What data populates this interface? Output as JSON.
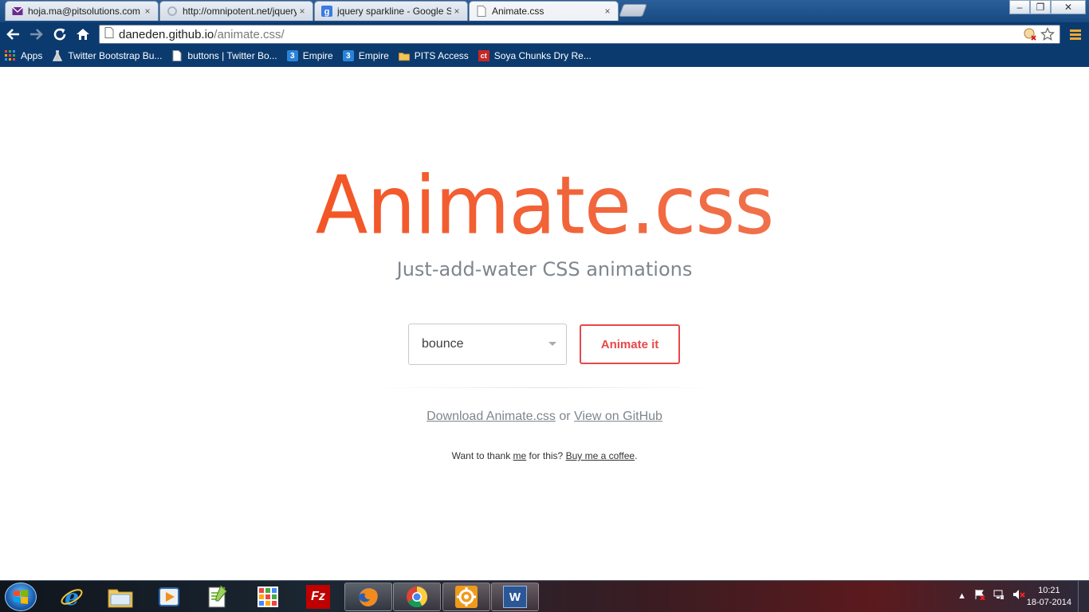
{
  "browser": {
    "tabs": [
      {
        "label": "hoja.ma@pitsolutions.com",
        "icon": "mail-icon",
        "active": false
      },
      {
        "label": "http://omnipotent.net/jquery",
        "icon": "loading-icon",
        "active": false
      },
      {
        "label": "jquery sparkline - Google Search",
        "icon": "google-icon",
        "active": false
      },
      {
        "label": "Animate.css",
        "icon": "page-icon",
        "active": true
      }
    ],
    "close_glyph": "×",
    "window_buttons": {
      "minimize": "–",
      "restore": "❐",
      "close": "✕"
    },
    "address": {
      "host": "daneden.github.io",
      "path": "/animate.css/"
    },
    "bookmarks": [
      {
        "label": "Apps",
        "icon": "apps-grid-icon"
      },
      {
        "label": "Twitter Bootstrap Bu...",
        "icon": "flask-icon"
      },
      {
        "label": "buttons | Twitter Bo...",
        "icon": "page-icon"
      },
      {
        "label": "Empire",
        "icon": "empire-icon",
        "glyph": "3"
      },
      {
        "label": "Empire",
        "icon": "empire-icon",
        "glyph": "3"
      },
      {
        "label": "PITS Access",
        "icon": "folder-icon"
      },
      {
        "label": "Soya Chunks Dry Re...",
        "icon": "ct-icon",
        "glyph": "ct"
      }
    ]
  },
  "page": {
    "title": "Animate.css",
    "subtitle": "Just-add-water CSS animations",
    "select_value": "bounce",
    "animate_button": "Animate it",
    "download_link": "Download Animate.css",
    "or_text": " or ",
    "github_link": "View on GitHub",
    "thanks_prefix": "Want to thank ",
    "thanks_me": "me",
    "thanks_middle": " for this? ",
    "coffee_link": "Buy me a coffee",
    "thanks_suffix": "."
  },
  "taskbar": {
    "apps": [
      {
        "name": "internet-explorer-icon",
        "open": false
      },
      {
        "name": "file-explorer-icon",
        "open": false
      },
      {
        "name": "media-player-icon",
        "open": false
      },
      {
        "name": "notepad-plus-icon",
        "open": false
      },
      {
        "name": "apps-grid-icon",
        "open": false
      },
      {
        "name": "filezilla-icon",
        "open": false,
        "glyph": "Fz"
      },
      {
        "name": "firefox-icon",
        "open": true
      },
      {
        "name": "chrome-icon",
        "open": true
      },
      {
        "name": "settings-gear-icon",
        "open": true
      },
      {
        "name": "word-icon",
        "open": true,
        "glyph": "W"
      }
    ],
    "tray_arrow": "▲",
    "time": "10:21",
    "date": "18-07-2014"
  },
  "colors": {
    "title_orange": "#f35626",
    "button_red": "#e8484a",
    "subtitle_gray": "#7f868e",
    "chrome_blue": "#0b3a6e"
  }
}
